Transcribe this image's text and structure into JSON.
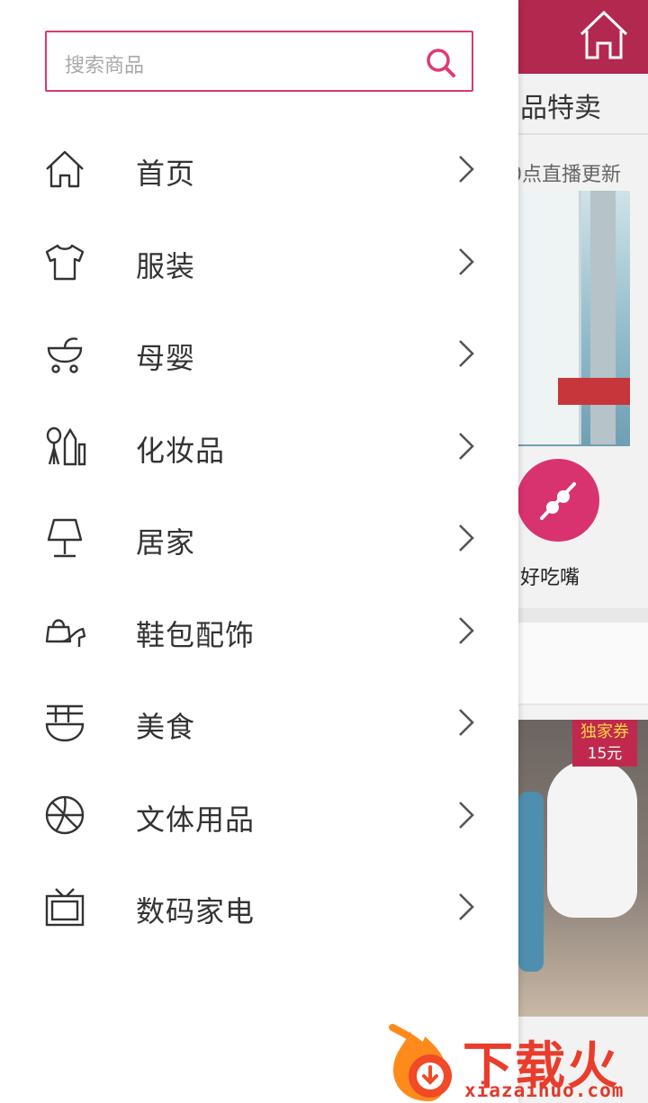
{
  "drawer": {
    "search": {
      "placeholder": "搜索商品"
    },
    "menu": [
      {
        "label": "首页",
        "icon": "home-icon"
      },
      {
        "label": "服装",
        "icon": "tshirt-icon"
      },
      {
        "label": "母婴",
        "icon": "stroller-icon"
      },
      {
        "label": "化妆品",
        "icon": "cosmetics-icon"
      },
      {
        "label": "居家",
        "icon": "lamp-icon"
      },
      {
        "label": "鞋包配饰",
        "icon": "shoe-bag-icon"
      },
      {
        "label": "美食",
        "icon": "noodle-bowl-icon"
      },
      {
        "label": "文体用品",
        "icon": "basketball-icon"
      },
      {
        "label": "数码家电",
        "icon": "tv-icon"
      }
    ]
  },
  "background": {
    "section_title": "品特卖",
    "subtitle": "0点直播更新",
    "category_label": "好吃嘴",
    "badge": {
      "line1": "独家券",
      "line2": "15元"
    }
  },
  "watermark": {
    "text": "下载火",
    "url": "xiazaihuo.com"
  },
  "colors": {
    "accent": "#d63a6e",
    "topbar": "#b3284f",
    "watermark": "#ea3c2c"
  }
}
